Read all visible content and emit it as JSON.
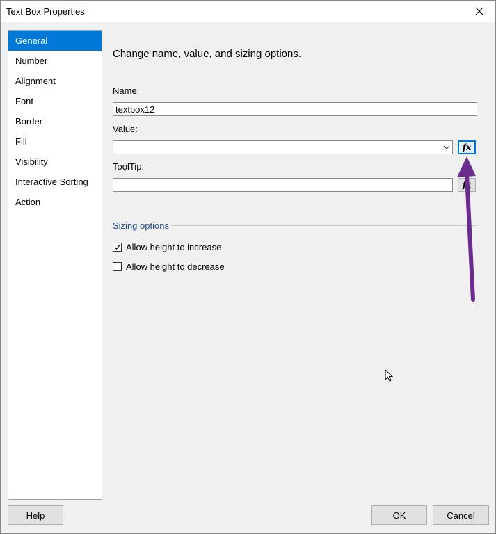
{
  "window": {
    "title": "Text Box Properties"
  },
  "sidebar": {
    "items": [
      {
        "label": "General",
        "active": true
      },
      {
        "label": "Number"
      },
      {
        "label": "Alignment"
      },
      {
        "label": "Font"
      },
      {
        "label": "Border"
      },
      {
        "label": "Fill"
      },
      {
        "label": "Visibility"
      },
      {
        "label": "Interactive Sorting"
      },
      {
        "label": "Action"
      }
    ]
  },
  "main": {
    "heading": "Change name, value, and sizing options.",
    "name_label": "Name:",
    "name_value": "textbox12",
    "value_label": "Value:",
    "value_value": "",
    "tooltip_label": "ToolTip:",
    "tooltip_value": "",
    "fx_label": "fx",
    "sizing": {
      "title": "Sizing options",
      "allow_increase": {
        "label": "Allow height to increase",
        "checked": true
      },
      "allow_decrease": {
        "label": "Allow height to decrease",
        "checked": false
      }
    }
  },
  "footer": {
    "help_label": "Help",
    "ok_label": "OK",
    "cancel_label": "Cancel"
  },
  "colors": {
    "accent": "#0078d7",
    "annotation_arrow": "#6a2c8f"
  },
  "icons": [
    "close-icon",
    "chevron-down-icon",
    "fx-icon",
    "checkmark-icon",
    "mouse-cursor-icon"
  ]
}
